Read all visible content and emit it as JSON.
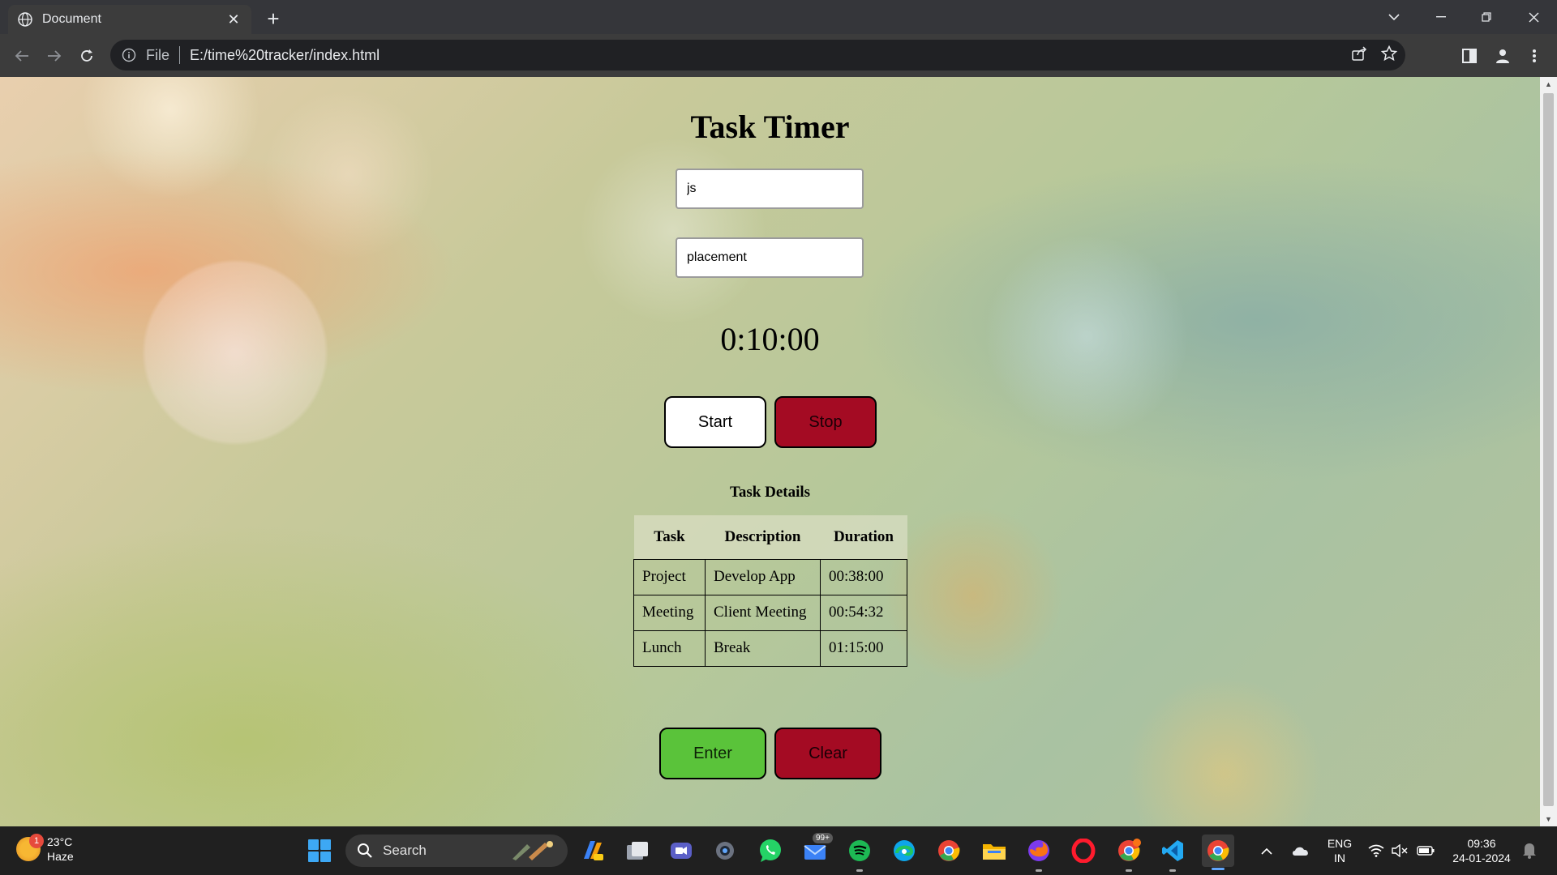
{
  "browser": {
    "tab_title": "Document",
    "address_scheme": "File",
    "address_url": "E:/time%20tracker/index.html"
  },
  "page": {
    "title": "Task Timer",
    "task_input_value": "js",
    "description_input_value": "placement",
    "timer_display": "0:10:00",
    "start_label": "Start",
    "stop_label": "Stop",
    "table_caption": "Task Details",
    "table": {
      "headers": [
        "Task",
        "Description",
        "Duration"
      ],
      "rows": [
        [
          "Project",
          "Develop App",
          "00:38:00"
        ],
        [
          "Meeting",
          "Client Meeting",
          "00:54:32"
        ],
        [
          "Lunch",
          "Break",
          "01:15:00"
        ]
      ]
    },
    "enter_label": "Enter",
    "clear_label": "Clear",
    "colors": {
      "stop": "#a40b23",
      "enter": "#5ac33a"
    }
  },
  "taskbar": {
    "weather_badge": "1",
    "temperature": "23°C",
    "condition": "Haze",
    "search_label": "Search",
    "mail_badge": "99+",
    "language_line1": "ENG",
    "language_line2": "IN",
    "time": "09:36",
    "date": "24-01-2024"
  }
}
